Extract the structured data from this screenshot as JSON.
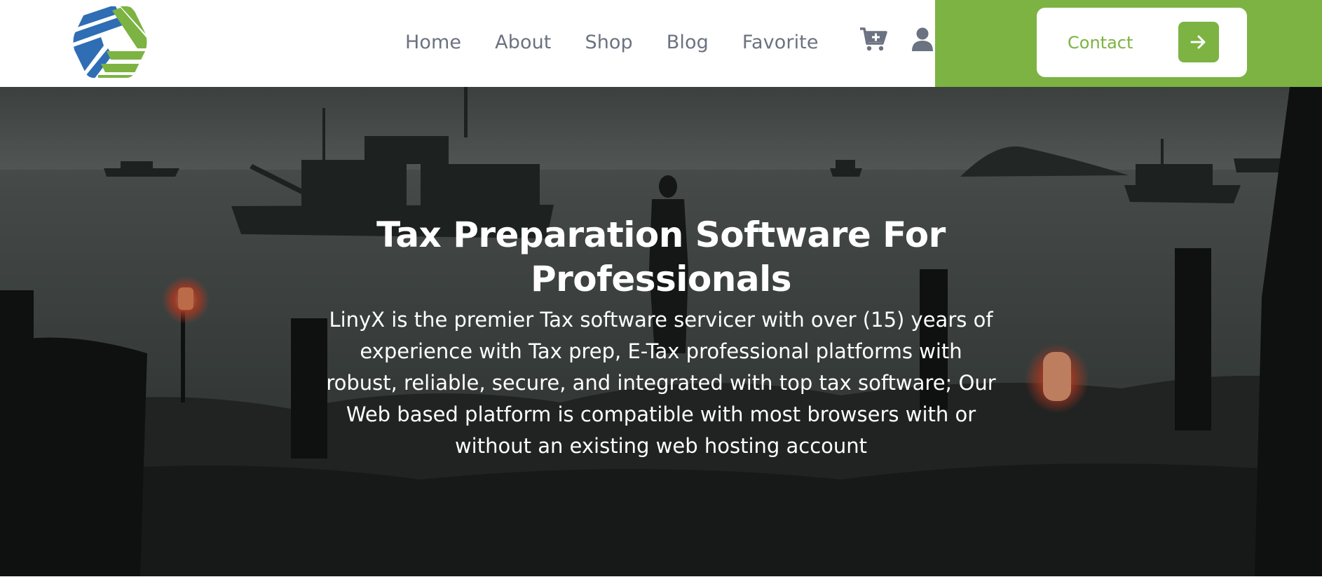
{
  "nav": {
    "items": [
      {
        "label": "Home"
      },
      {
        "label": "About"
      },
      {
        "label": "Shop"
      },
      {
        "label": "Blog"
      },
      {
        "label": "Favorite"
      }
    ],
    "cart_icon": "cart-plus-icon",
    "user_icon": "user-icon"
  },
  "contact": {
    "label": "Contact",
    "icon": "arrow-right-icon"
  },
  "hero": {
    "title": "Tax Preparation Software For Professionals",
    "text": "LinyX is the premier Tax software servicer with over (15) years of experience with Tax prep, E-Tax professional platforms with robust, reliable, secure, and integrated with top tax software; Our Web based platform is compatible with most browsers with or without an existing web hosting account"
  },
  "colors": {
    "brand_green": "#7cb342",
    "brand_blue": "#2f6db5",
    "nav_text": "#6b7280"
  }
}
